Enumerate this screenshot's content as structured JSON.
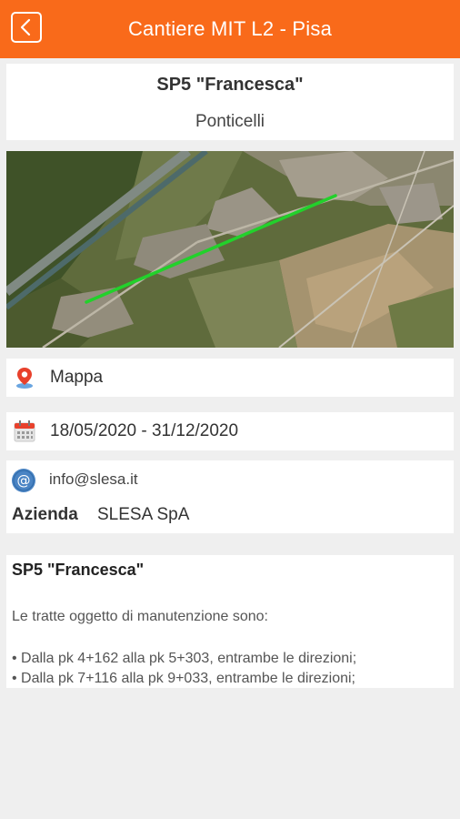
{
  "appbar": {
    "title": "Cantiere MIT L2 - Pisa"
  },
  "site": {
    "road": "SP5 \"Francesca\"",
    "location": "Ponticelli"
  },
  "map_row": {
    "label": "Mappa",
    "icon": "location-pin-icon"
  },
  "dates_row": {
    "label": "18/05/2020 - 31/12/2020",
    "icon": "calendar-icon"
  },
  "contact": {
    "email": "info@slesa.it",
    "email_icon": "at-icon",
    "company_label": "Azienda",
    "company_value": "SLESA SpA"
  },
  "description": {
    "title": "SP5 \"Francesca\"",
    "intro": "Le tratte oggetto di manutenzione sono:",
    "bullets": [
      "• Dalla pk 4+162 alla pk 5+303, entrambe le direzioni;",
      "• Dalla pk 7+116 alla pk 9+033, entrambe le direzioni;"
    ]
  },
  "colors": {
    "accent": "#f96a1a",
    "route": "#22d12b"
  }
}
